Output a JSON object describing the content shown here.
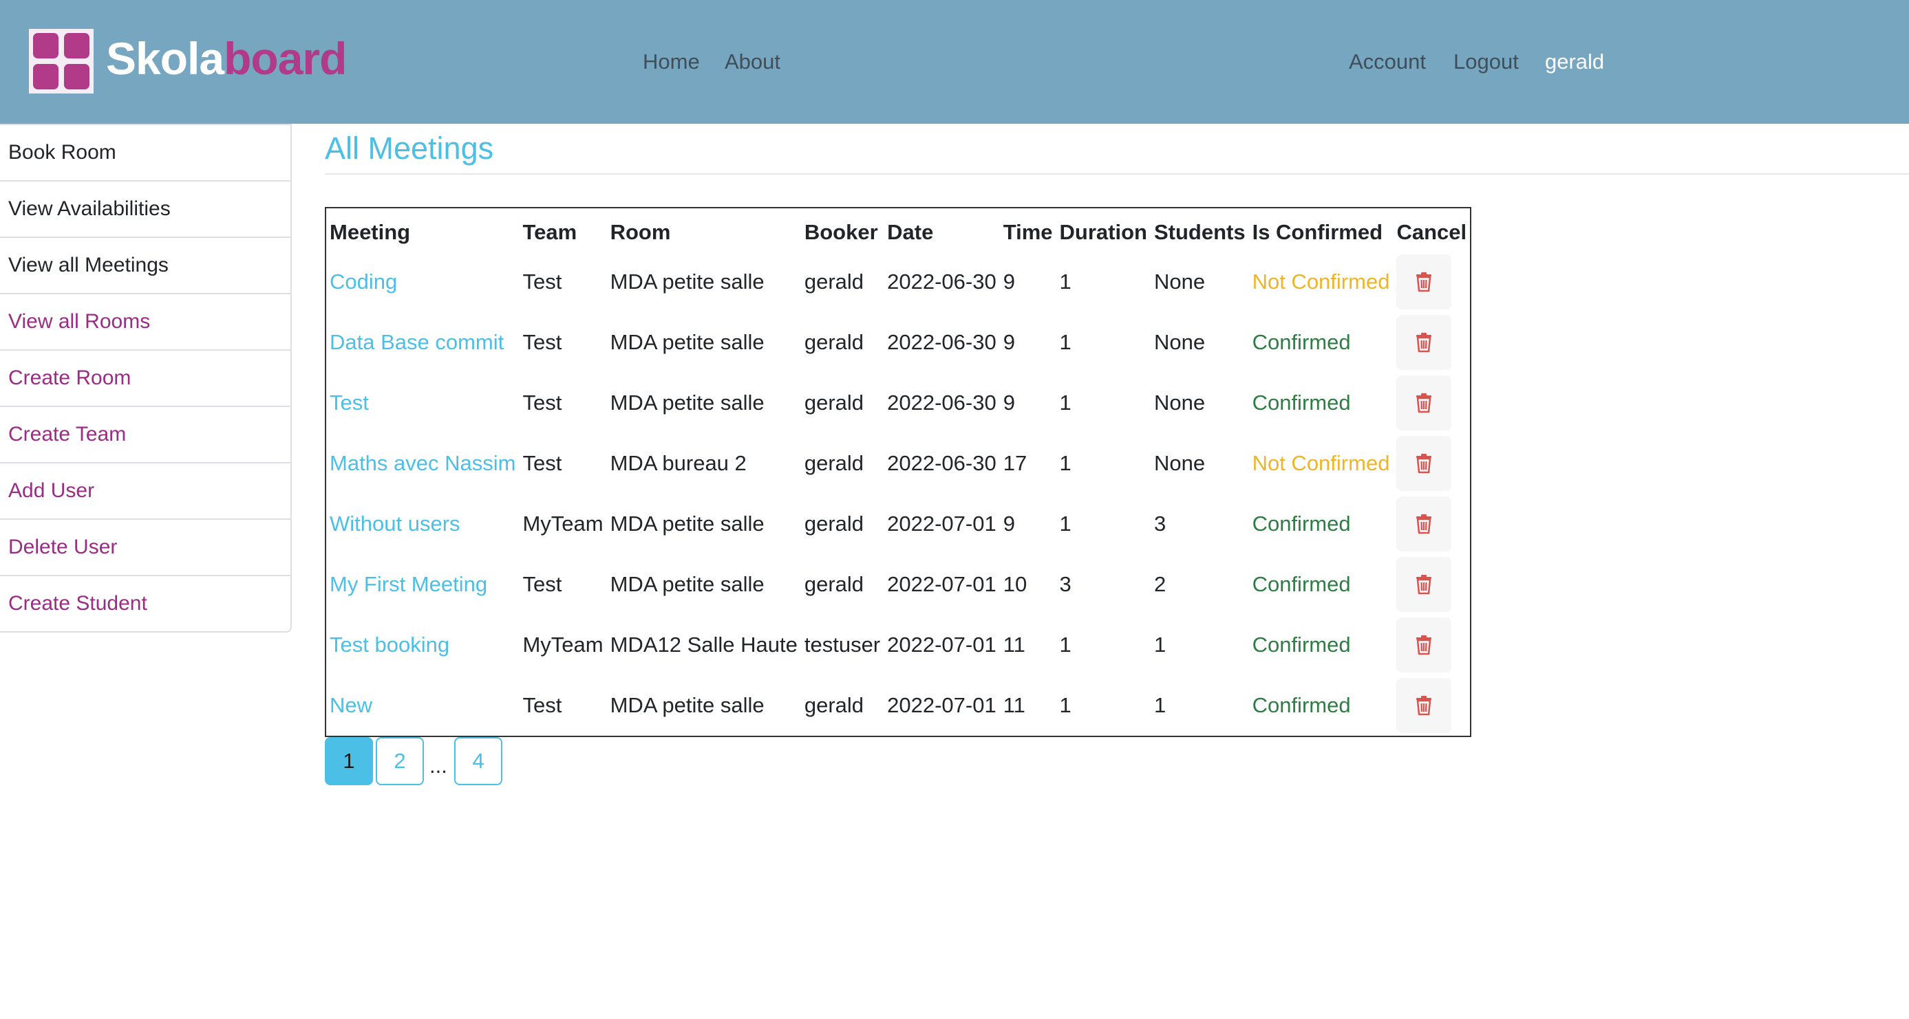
{
  "brand": {
    "part1": "Skola",
    "part2": "board",
    "accent": "#b13a89"
  },
  "nav": {
    "home": "Home",
    "about": "About",
    "account": "Account",
    "logout": "Logout",
    "user": "gerald"
  },
  "sidebar": {
    "items": [
      {
        "label": "Book Room"
      },
      {
        "label": "View Availabilities"
      },
      {
        "label": "View all Meetings"
      },
      {
        "label": "View all Rooms"
      },
      {
        "label": "Create Room"
      },
      {
        "label": "Create Team"
      },
      {
        "label": "Add User"
      },
      {
        "label": "Delete User"
      },
      {
        "label": "Create Student"
      }
    ]
  },
  "main": {
    "title": "All Meetings"
  },
  "table": {
    "headers": [
      "Meeting",
      "Team",
      "Room",
      "Booker",
      "Date",
      "Time",
      "Duration",
      "Students",
      "Is Confirmed",
      "Cancel"
    ],
    "rows": [
      {
        "meeting": "Coding",
        "team": "Test",
        "room": "MDA petite salle",
        "booker": "gerald",
        "date": "2022-06-30",
        "time": "9",
        "duration": "1",
        "students": "None",
        "status": "Not Confirmed"
      },
      {
        "meeting": "Data Base commit",
        "team": "Test",
        "room": "MDA petite salle",
        "booker": "gerald",
        "date": "2022-06-30",
        "time": "9",
        "duration": "1",
        "students": "None",
        "status": "Confirmed"
      },
      {
        "meeting": "Test",
        "team": "Test",
        "room": "MDA petite salle",
        "booker": "gerald",
        "date": "2022-06-30",
        "time": "9",
        "duration": "1",
        "students": "None",
        "status": "Confirmed"
      },
      {
        "meeting": "Maths avec Nassim",
        "team": "Test",
        "room": "MDA bureau 2",
        "booker": "gerald",
        "date": "2022-06-30",
        "time": "17",
        "duration": "1",
        "students": "None",
        "status": "Not Confirmed"
      },
      {
        "meeting": "Without users",
        "team": "MyTeam",
        "room": "MDA petite salle",
        "booker": "gerald",
        "date": "2022-07-01",
        "time": "9",
        "duration": "1",
        "students": "3",
        "status": "Confirmed"
      },
      {
        "meeting": "My First Meeting",
        "team": "Test",
        "room": "MDA petite salle",
        "booker": "gerald",
        "date": "2022-07-01",
        "time": "10",
        "duration": "3",
        "students": "2",
        "status": "Confirmed"
      },
      {
        "meeting": "Test booking",
        "team": "MyTeam",
        "room": "MDA12 Salle Haute",
        "booker": "testuser",
        "date": "2022-07-01",
        "time": "11",
        "duration": "1",
        "students": "1",
        "status": "Confirmed"
      },
      {
        "meeting": "New",
        "team": "Test",
        "room": "MDA petite salle",
        "booker": "gerald",
        "date": "2022-07-01",
        "time": "11",
        "duration": "1",
        "students": "1",
        "status": "Confirmed"
      }
    ]
  },
  "pagination": {
    "pages": [
      "1",
      "2",
      "4"
    ],
    "ellipsis": "...",
    "current": "1"
  },
  "colors": {
    "header": "#77a7c0",
    "link": "#4cbfe6",
    "confirmed": "#2e7d45",
    "not_confirmed": "#f0b429",
    "delete": "#d9534f"
  }
}
